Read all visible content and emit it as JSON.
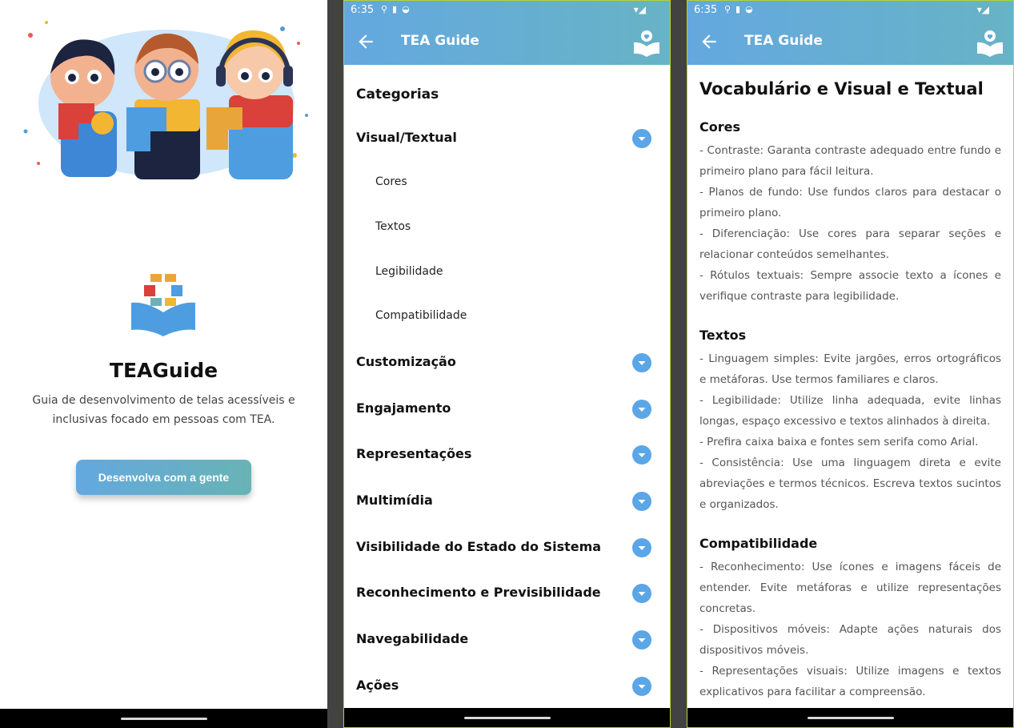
{
  "status_bar": {
    "time": "6:35"
  },
  "splash": {
    "app_name": "TEAGuide",
    "description": "Guia de desenvolvimento de telas acessíveis e inclusivas focado em pessoas com TEA.",
    "cta_label": "Desenvolva com a gente"
  },
  "header": {
    "title": "TEA Guide"
  },
  "categories": {
    "heading": "Categorias",
    "expanded": {
      "label": "Visual/Textual",
      "children": [
        "Cores",
        "Textos",
        "Legibilidade",
        "Compatibilidade"
      ]
    },
    "collapsed": [
      "Customização",
      "Engajamento",
      "Representações",
      "Multimídia",
      "Visibilidade do Estado do Sistema",
      "Reconhecimento e Previsibilidade",
      "Navegabilidade",
      "Ações"
    ]
  },
  "detail": {
    "title": "Vocabulário e Visual e Textual",
    "sections": [
      {
        "title": "Cores",
        "items": [
          "- Contraste: Garanta contraste adequado entre fundo e primeiro plano para fácil leitura.",
          "- Planos de fundo: Use fundos claros para destacar o primeiro plano.",
          "- Diferenciação: Use cores para separar seções e relacionar conteúdos semelhantes.",
          "- Rótulos textuais: Sempre associe texto a ícones e verifique contraste para legibilidade."
        ]
      },
      {
        "title": "Textos",
        "items": [
          "- Linguagem simples: Evite jargões, erros ortográficos e metáforas. Use termos familiares e claros.",
          "- Legibilidade: Utilize linha adequada, evite linhas longas, espaço excessivo e textos alinhados à direita.",
          "- Prefira caixa baixa e fontes sem serifa como Arial.",
          "- Consistência: Use uma linguagem direta e evite abreviações e termos técnicos. Escreva textos sucintos e organizados."
        ]
      },
      {
        "title": "Compatibilidade",
        "items": [
          "- Reconhecimento: Use ícones e imagens fáceis de entender. Evite metáforas e utilize representações concretas.",
          "- Dispositivos móveis: Adapte ações naturais dos dispositivos móveis.",
          "- Representações visuais: Utilize imagens e textos explicativos para facilitar a compreensão."
        ]
      }
    ]
  },
  "colors": {
    "accent": "#64a8df",
    "accent_teal": "#68b3b5",
    "chevron": "#5aa6e6"
  }
}
